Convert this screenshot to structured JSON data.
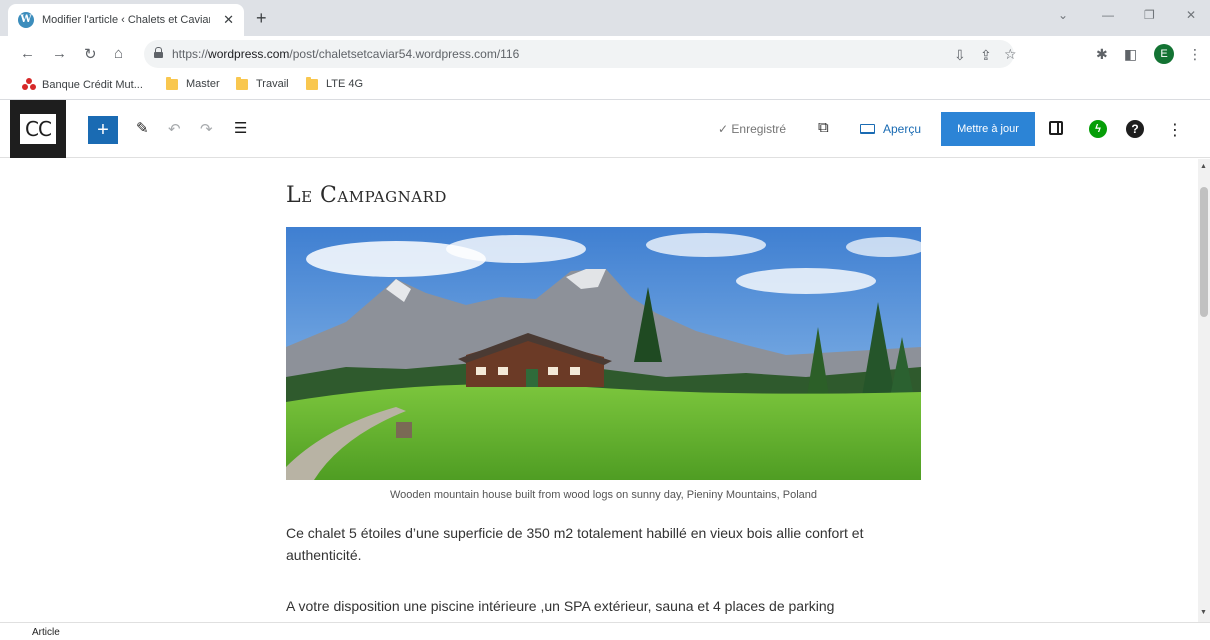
{
  "browser": {
    "tab_title": "Modifier l'article ‹ Chalets et Caviar",
    "tab_close": "✕",
    "new_tab": "+",
    "url_prefix": "https://",
    "url_domain": "wordpress.com",
    "url_path": "/post/chaletsetcaviar54.wordpress.com/116",
    "profile_initial": "E",
    "bookmarks": [
      "Banque Crédit Mut...",
      "Master",
      "Travail",
      "LTE 4G"
    ]
  },
  "editor": {
    "site_logo": "CC",
    "saved_label": "✓ Enregistré",
    "preview_label": "Aperçu",
    "update_label": "Mettre à jour",
    "icons": [
      "plus-icon",
      "pencil-icon",
      "undo-icon",
      "redo-icon",
      "list-view-icon",
      "external-link-icon",
      "settings-panel-icon",
      "jetpack-icon",
      "help-icon",
      "more-options-icon"
    ]
  },
  "post": {
    "title": "Le Campagnard",
    "image_caption": "Wooden mountain house built from wood logs on sunny day, Pieniny Mountains, Poland",
    "paragraph_1": "Ce chalet 5 étoiles d’une superficie de  350 m2 totalement habillé en vieux bois allie confort et authenticité.",
    "paragraph_2": "A votre disposition une piscine intérieure ,un SPA extérieur, sauna et 4 places de parking"
  },
  "statusbar": {
    "label": "Article"
  }
}
